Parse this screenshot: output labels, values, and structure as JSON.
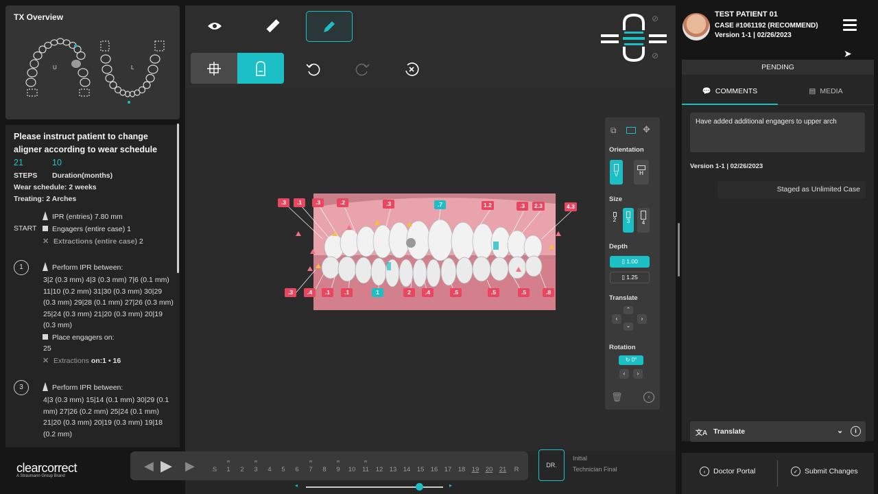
{
  "tx_overview": {
    "title": "TX Overview",
    "upper_label": "U",
    "lower_label": "L"
  },
  "instructions": {
    "message": "Please instruct patient to change aligner according to wear schedule",
    "steps_value": "21",
    "duration_value": "10",
    "steps_label": "STEPS",
    "duration_label": "Duration(months)",
    "wear_schedule": "Wear schedule: 2 weeks",
    "treating": "Treating: 2 Arches"
  },
  "start": {
    "label": "START",
    "ipr": "IPR (entries) 7.80 mm",
    "engagers": "Engagers (entire case) 1",
    "extractions": "Extractions (entire case)",
    "extractions_count": "2"
  },
  "step1": {
    "num": "1",
    "ipr_title": "Perform IPR between:",
    "ipr_details": "3|2 (0.3 mm) 4|3 (0.3 mm) 7|6 (0.1 mm) 11|10 (0.2 mm) 31|30 (0.3 mm) 30|29 (0.3 mm) 29|28 (0.1 mm) 27|26 (0.3 mm) 25|24 (0.3 mm) 21|20 (0.3 mm) 20|19 (0.3 mm)",
    "engagers_title": "Place engagers on:",
    "engagers_value": "25",
    "extractions_label": "Extractions",
    "extractions_value": "on:1 • 16"
  },
  "step3": {
    "num": "3",
    "ipr_title": "Perform IPR between:",
    "ipr_details": "4|3 (0.3 mm) 15|14 (0.1 mm) 30|29 (0.1 mm) 27|26 (0.2 mm) 25|24 (0.1 mm) 21|20 (0.3 mm) 20|19 (0.3 mm) 19|18 (0.2 mm)"
  },
  "brand": {
    "name": "clearcorrect",
    "sub": "A Straumann Group Brand"
  },
  "toolbar": {
    "view_icon": "eye-icon",
    "ruler_icon": "ruler-icon",
    "edit_icon": "pencil-icon",
    "undo_icon": "undo-icon",
    "redo_icon": "redo-icon",
    "reset_icon": "reset-icon"
  },
  "tooth_labels_upper": [
    ".3",
    ".1",
    ".3",
    ".2",
    ".3",
    ".7",
    "1.2",
    ".3",
    "2.3",
    "4.3"
  ],
  "tooth_labels_lower": [
    ".3",
    ".4",
    ".1",
    ".1",
    "1",
    "2",
    ".4",
    ".5",
    ".5",
    ".5",
    ".8"
  ],
  "tools_panel": {
    "orientation_label": "Orientation",
    "orientation_v": "V",
    "orientation_h": "H",
    "size_label": "Size",
    "sizes": [
      "2",
      "3",
      "4"
    ],
    "depth_label": "Depth",
    "depth_values": [
      "1.00",
      "1.25"
    ],
    "translate_label": "Translate",
    "rotation_label": "Rotation",
    "rotation_value": "0°"
  },
  "timeline": {
    "steps": [
      "S",
      "1",
      "2",
      "3",
      "4",
      "5",
      "6",
      "7",
      "8",
      "9",
      "10",
      "11",
      "12",
      "13",
      "14",
      "15",
      "16",
      "17",
      "18",
      "19",
      "20",
      "21",
      "R"
    ],
    "dr_label": "DR.",
    "initial_label": "Initial",
    "final_label": "Technician Final"
  },
  "patient": {
    "name": "TEST PATIENT 01",
    "case": "CASE #1061192 (RECOMMEND)",
    "version": "Version 1-1 | 02/26/2023"
  },
  "comments": {
    "status": "PENDING",
    "tab_comments": "COMMENTS",
    "tab_media": "MEDIA",
    "input_text": "Have added additional engagers to upper arch",
    "version_stamp": "Version 1-1 | 02/26/2023",
    "staged_note": "Staged as Unlimited Case",
    "translate_label": "Translate"
  },
  "footer": {
    "doctor_portal": "Doctor Portal",
    "submit_changes": "Submit Changes"
  },
  "colors": {
    "accent": "#1dbfc7",
    "label_red": "#e9475f",
    "background": "#161616"
  }
}
